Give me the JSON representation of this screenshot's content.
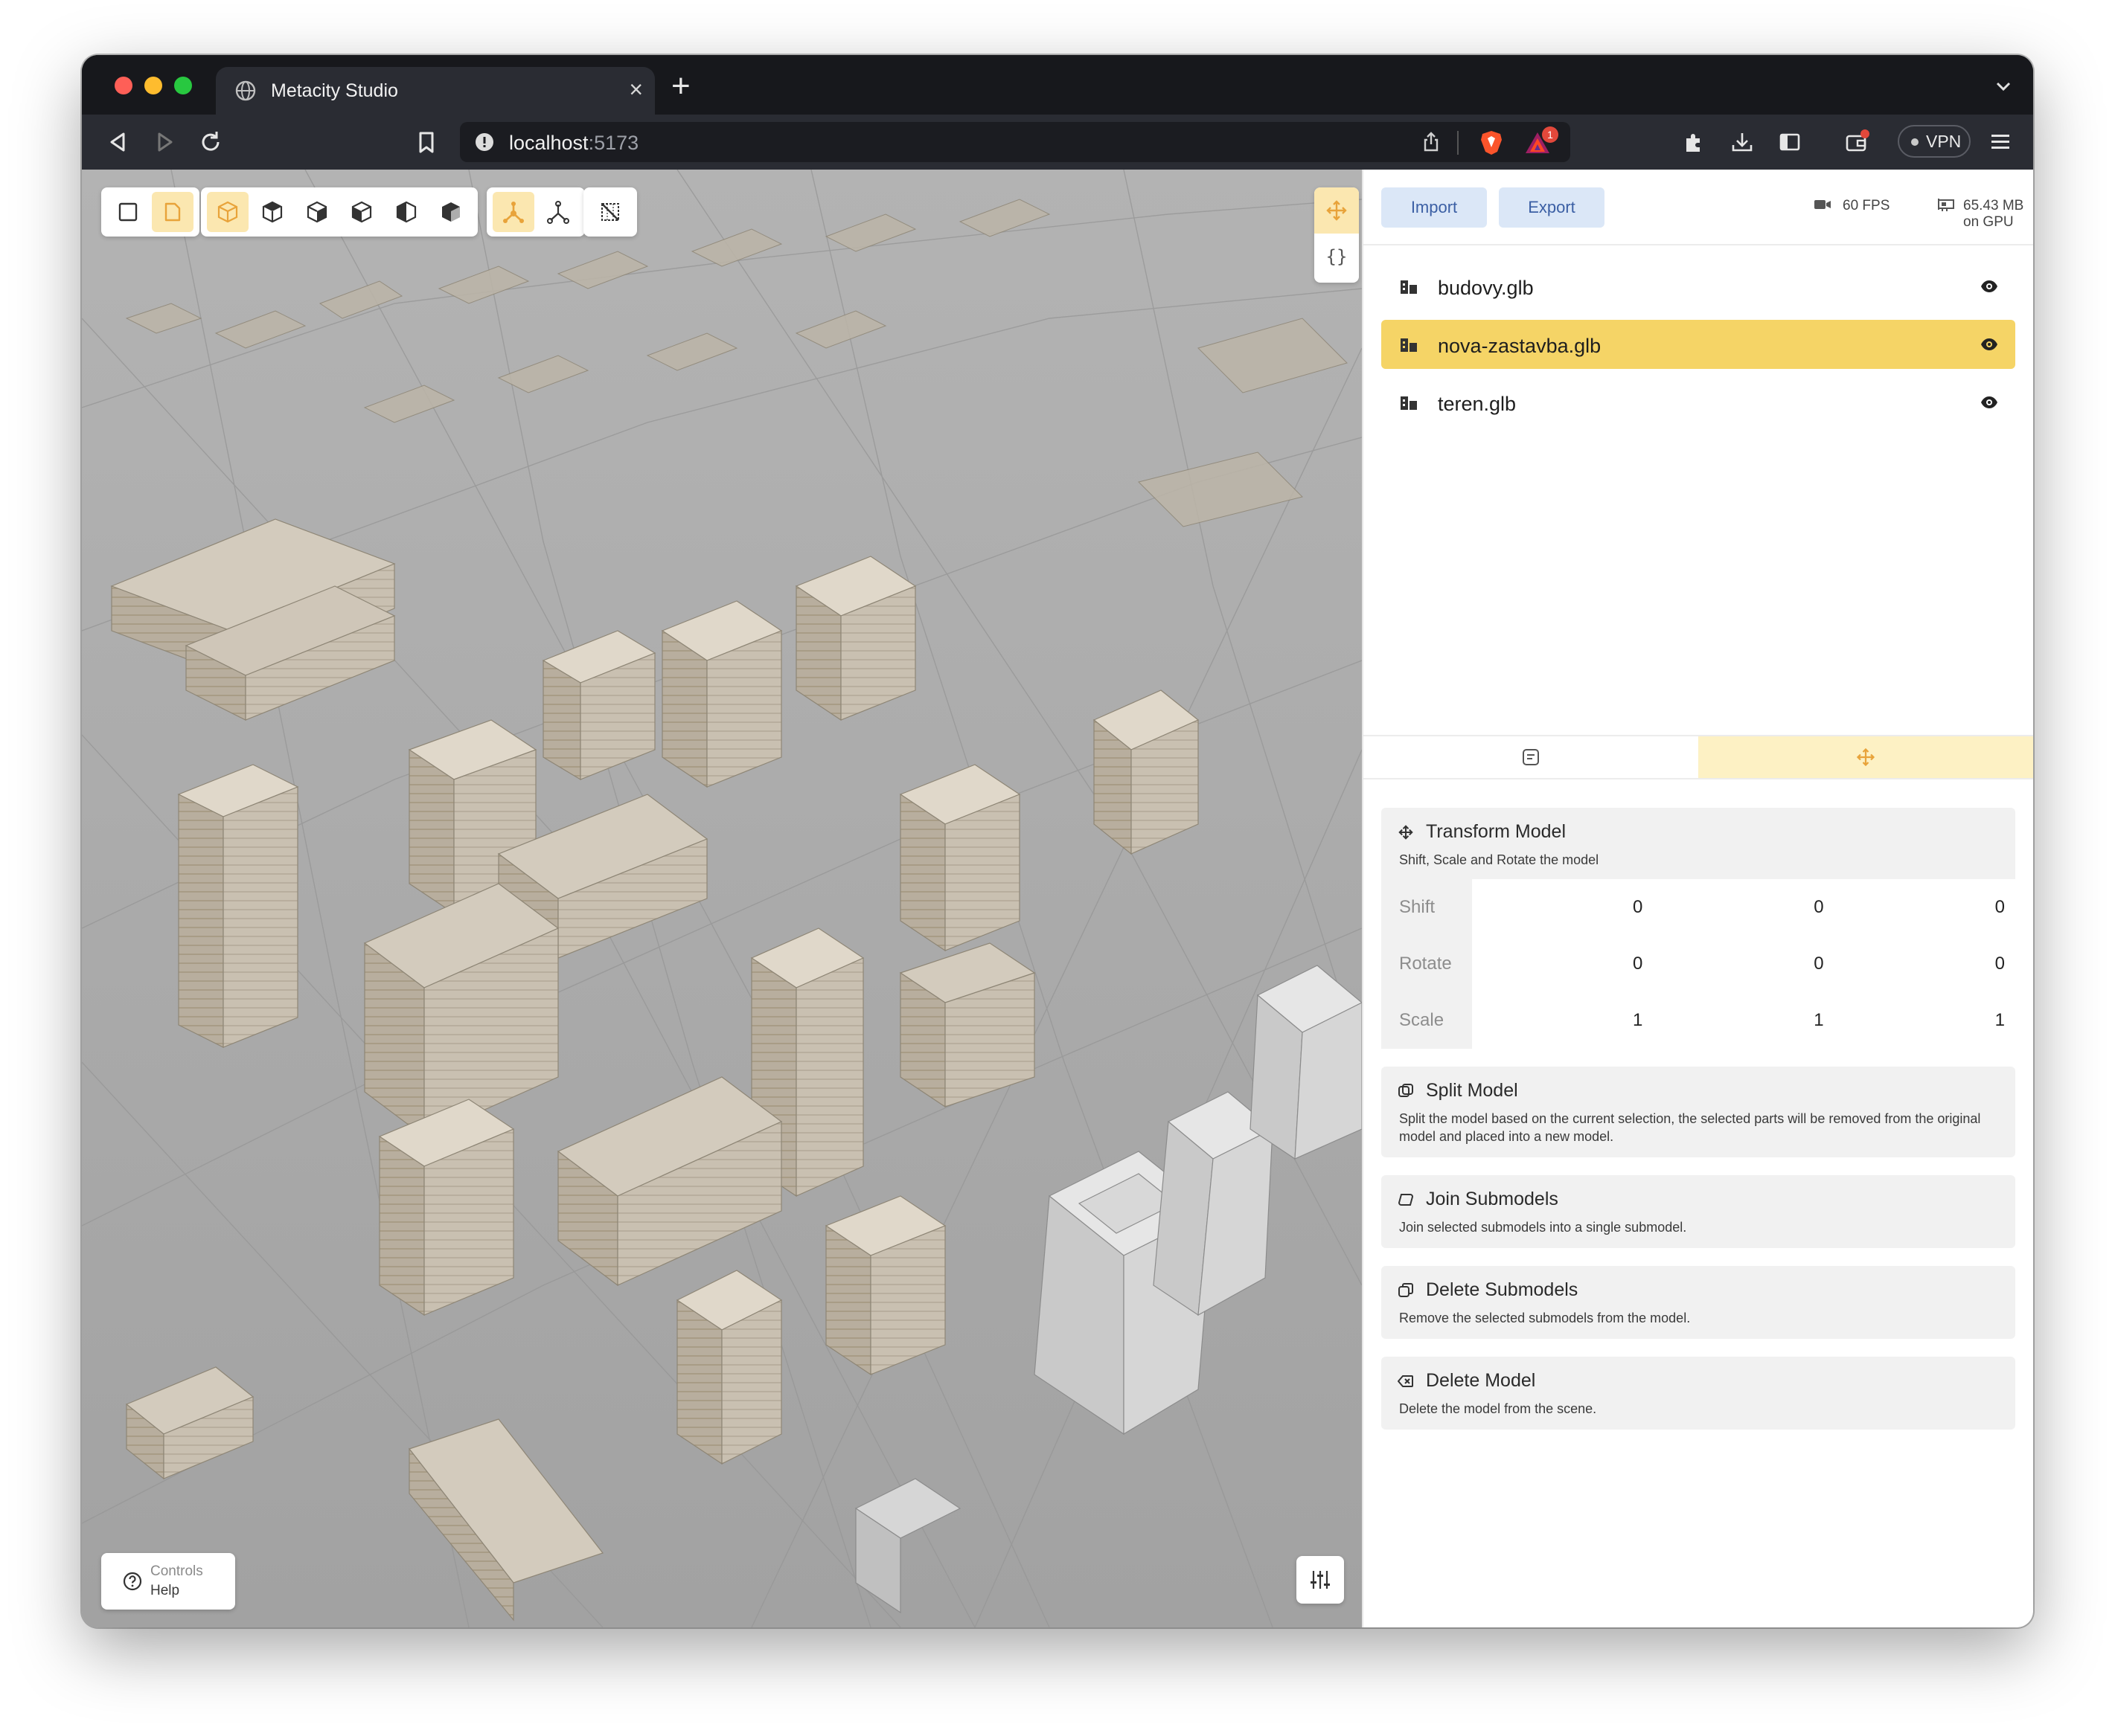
{
  "browser": {
    "tab_title": "Metacity Studio",
    "url_host": "localhost",
    "url_port": ":5173",
    "notification_count": "1",
    "vpn_label": "VPN"
  },
  "panel": {
    "import_label": "Import",
    "export_label": "Export",
    "fps": "60 FPS",
    "gpu_memory": "65.43 MB on GPU",
    "files": [
      {
        "name": "budovy.glb",
        "selected": false
      },
      {
        "name": "nova-zastavba.glb",
        "selected": true
      },
      {
        "name": "teren.glb",
        "selected": false
      }
    ]
  },
  "operations": {
    "transform": {
      "title": "Transform Model",
      "description": "Shift, Scale and Rotate the model",
      "rows": [
        {
          "label": "Shift",
          "values": [
            "0",
            "0",
            "0"
          ]
        },
        {
          "label": "Rotate",
          "values": [
            "0",
            "0",
            "0"
          ]
        },
        {
          "label": "Scale",
          "values": [
            "1",
            "1",
            "1"
          ]
        }
      ]
    },
    "split": {
      "title": "Split Model",
      "description": "Split the model based on the current selection, the selected parts will be removed from the original model and placed into a new model."
    },
    "join": {
      "title": "Join Submodels",
      "description": "Join selected submodels into a single submodel."
    },
    "delete_sub": {
      "title": "Delete Submodels",
      "description": "Remove the selected submodels from the model."
    },
    "delete_model": {
      "title": "Delete Model",
      "description": "Delete the model from the scene."
    }
  },
  "viewport": {
    "controls_label": "Controls",
    "help_label": "Help"
  },
  "colors": {
    "accent": "#f5d466",
    "accent_light": "#fbe7b0",
    "tool_orange": "#e8a33a",
    "terrain": "#adadad",
    "building": "#cfc6b8"
  }
}
